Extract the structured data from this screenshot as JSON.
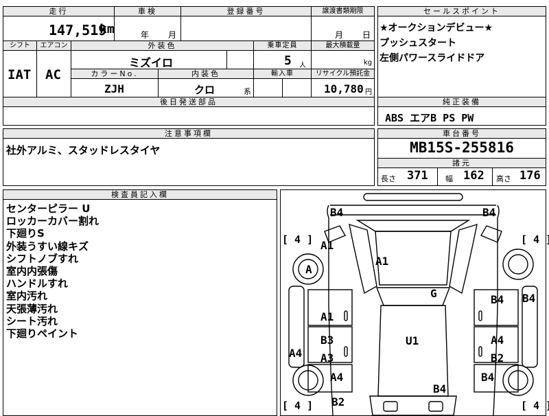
{
  "mileage": {
    "header": "走行",
    "value": "147,519",
    "unit": "km"
  },
  "shaken": {
    "header": "車検",
    "year_unit": "年",
    "month_unit": "月"
  },
  "registration": {
    "header": "登録番号"
  },
  "transfer_deadline": {
    "header": "譲渡書類期限",
    "month_unit": "月",
    "day_unit": "日"
  },
  "sales_points": {
    "header": "セールスポイント",
    "lines": [
      "★オークションデビュー★",
      "プッシュスタート",
      "左側パワースライドドア"
    ]
  },
  "shift": {
    "header": "シフト",
    "value": "IAT"
  },
  "aircon": {
    "header": "エアコン",
    "value": "AC"
  },
  "exterior_color": {
    "header": "外装色",
    "value": "ミズイロ"
  },
  "color_no": {
    "header": "カラーNo.",
    "value": "ZJH"
  },
  "interior_color": {
    "header": "内装色",
    "value": "クロ",
    "suffix": "系"
  },
  "capacity": {
    "header": "乗車定員",
    "value": "5",
    "unit": "人"
  },
  "max_load": {
    "header": "最大積載量",
    "unit": "kg"
  },
  "import": {
    "header": "輸入車"
  },
  "recycle": {
    "header": "リサイクル預託金",
    "value": "10,780",
    "unit": "円"
  },
  "later_parts": {
    "header": "後日発送部品"
  },
  "genuine_equipment": {
    "header": "純正装備",
    "value": "ABS エアB PS PW"
  },
  "notes": {
    "header": "注意事項欄",
    "value": "社外アルミ、スタッドレスタイヤ"
  },
  "chassis": {
    "header": "車台番号",
    "value": "MB15S-255816"
  },
  "specs": {
    "header": "諸元",
    "length_label": "長さ",
    "length": "371",
    "width_label": "幅",
    "width": "162",
    "height_label": "高さ",
    "height": "176"
  },
  "inspector": {
    "header": "検査員記入欄",
    "lines": [
      "センターピラー U",
      "ロッカーカバー割れ",
      "下廻りS",
      "外装うすい線キズ",
      "シフトノブすれ",
      "室内内張傷",
      "ハンドルすれ",
      "室内汚れ",
      "天張薄汚れ",
      "シート汚れ",
      "下廻りペイント"
    ]
  },
  "diagram": {
    "tire_depths": [
      "[ 4 ]",
      "[ 4 ]",
      "[ 4 ]",
      "[ 4 ]"
    ],
    "marks": {
      "b4_front_left": "B4",
      "b4_front_right": "B4",
      "a1_fender_left": "A1",
      "a_wheel": "A",
      "a1_hood": "A1",
      "g_windshield": "G",
      "b4_door_right_front": "B4",
      "b4_right_side": "B4",
      "a1_door_left_front": "A1",
      "a4_left_side": "A4",
      "u1_roof": "U1",
      "b3_left": "B3",
      "a3_left": "A3",
      "a4_right": "A4",
      "b2_right": "B2",
      "a4_rear_left": "A4",
      "b4_rear_right": "B4",
      "b4_rear": "B4",
      "b2_rear_left": "B2"
    }
  }
}
